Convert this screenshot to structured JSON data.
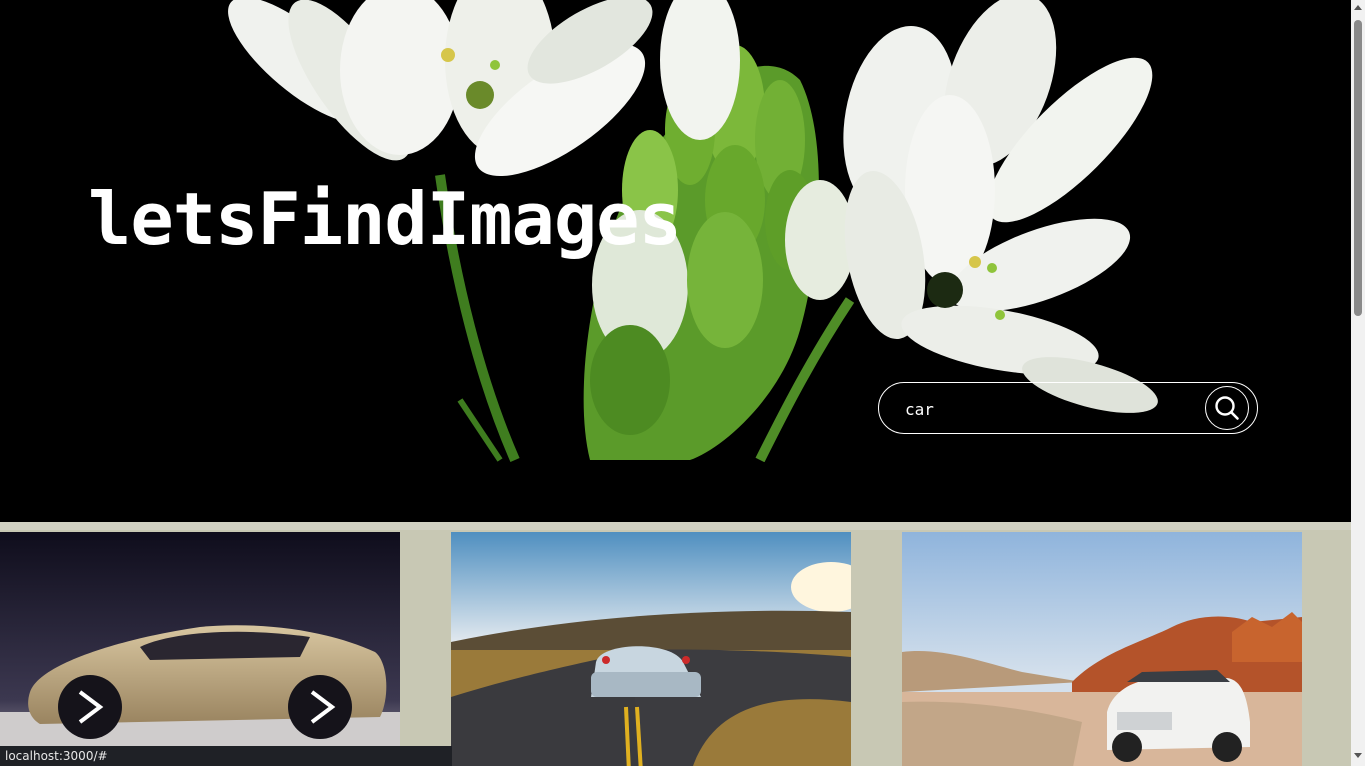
{
  "header": {
    "brand": "letsFindImages"
  },
  "search": {
    "value": "car",
    "icon": "search-icon"
  },
  "gallery": {
    "images": [
      {
        "subject": "concept-car-photo"
      },
      {
        "subject": "sports-car-road-photo"
      },
      {
        "subject": "suv-desert-photo"
      }
    ]
  },
  "status_bar": {
    "url": "localhost:3000/#"
  },
  "colors": {
    "hero_bg": "#000000",
    "page_bg": "#c8c8b4",
    "text": "#ffffff"
  }
}
